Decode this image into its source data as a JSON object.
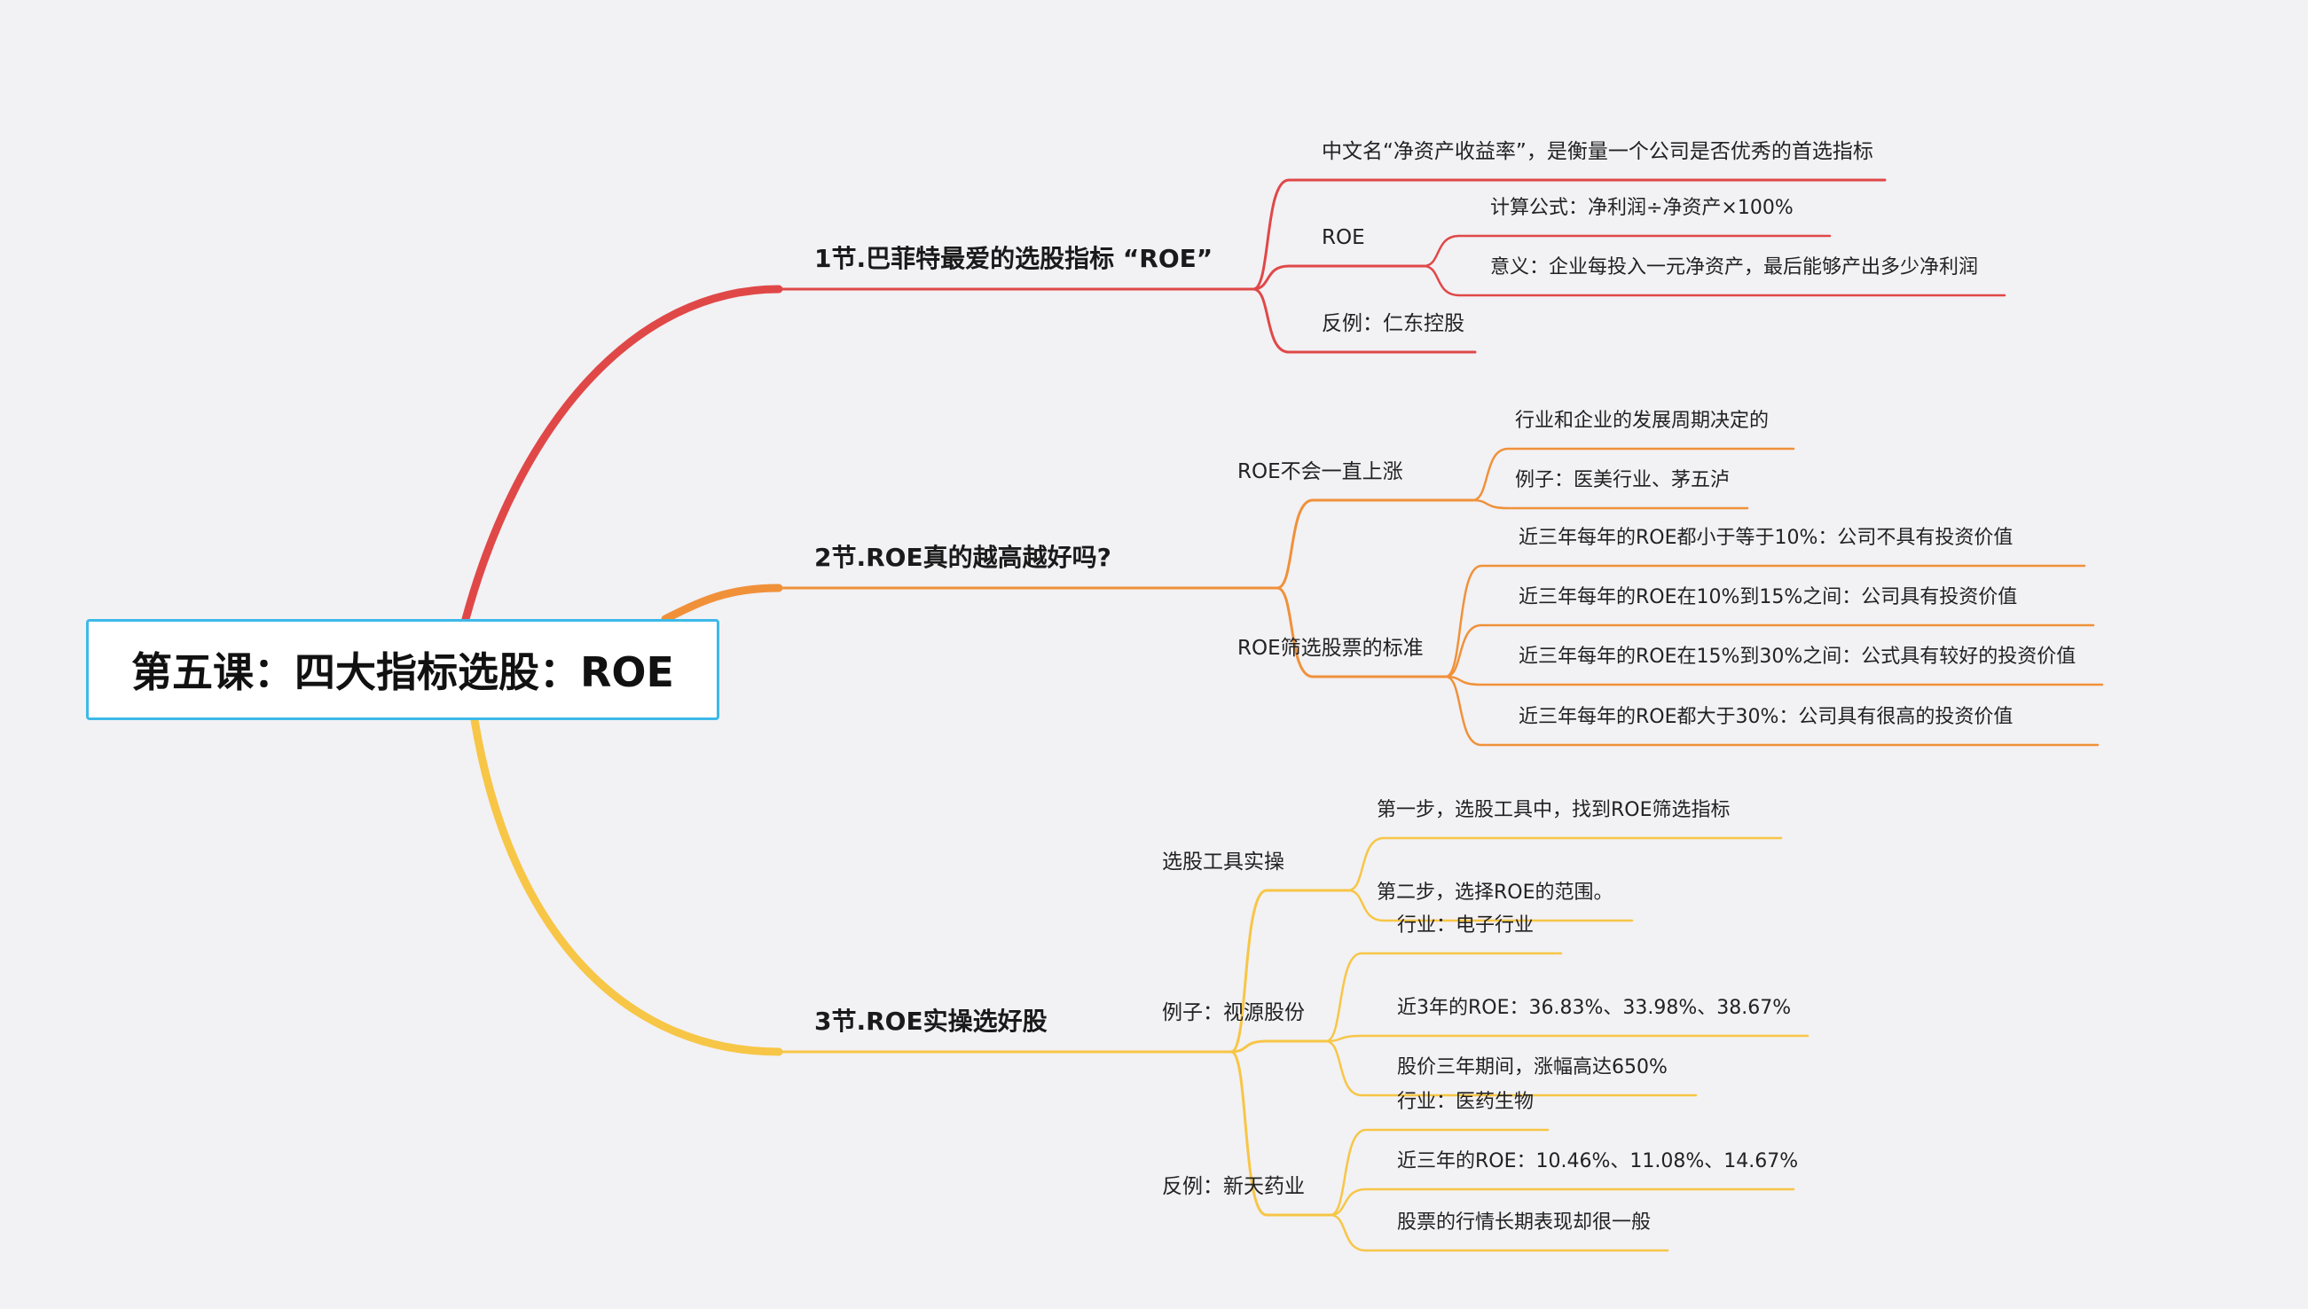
{
  "root": {
    "label": "第五课：四大指标选股：ROE",
    "border_color": "#3cb9e8"
  },
  "sections": [
    {
      "label": "1节.巴菲特最爱的选股指标 “ROE”",
      "color": "#e04848",
      "children": [
        {
          "label": "中文名“净资产收益率”，是衡量一个公司是否优秀的首选指标",
          "children": []
        },
        {
          "label": "ROE",
          "children": [
            {
              "label": "计算公式：净利润÷净资产×100%"
            },
            {
              "label": "意义：企业每投入一元净资产，最后能够产出多少净利润"
            }
          ]
        },
        {
          "label": "反例：仁东控股",
          "children": []
        }
      ]
    },
    {
      "label": "2节.ROE真的越高越好吗?",
      "color": "#f0913a",
      "children": [
        {
          "label": "ROE不会一直上涨",
          "children": [
            {
              "label": "行业和企业的发展周期决定的"
            },
            {
              "label": "例子：医美行业、茅五泸"
            }
          ]
        },
        {
          "label": "ROE筛选股票的标准",
          "children": [
            {
              "label": "近三年每年的ROE都小于等于10%：公司不具有投资价值"
            },
            {
              "label": "近三年每年的ROE在10%到15%之间：公司具有投资价值"
            },
            {
              "label": "近三年每年的ROE在15%到30%之间：公式具有较好的投资价值"
            },
            {
              "label": "近三年每年的ROE都大于30%：公司具有很高的投资价值"
            }
          ]
        }
      ]
    },
    {
      "label": "3节.ROE实操选好股",
      "color": "#f7c646",
      "children": [
        {
          "label": "选股工具实操",
          "children": [
            {
              "label": "第一步，选股工具中，找到ROE筛选指标"
            },
            {
              "label": "第二步，选择ROE的范围。"
            }
          ]
        },
        {
          "label": "例子：视源股份",
          "children": [
            {
              "label": "行业：电子行业"
            },
            {
              "label": "近3年的ROE：36.83%、33.98%、38.67%"
            },
            {
              "label": "股价三年期间，涨幅高达650%"
            }
          ]
        },
        {
          "label": "反例：新天药业",
          "children": [
            {
              "label": "行业：医药生物"
            },
            {
              "label": "近三年的ROE：10.46%、11.08%、14.67%"
            },
            {
              "label": "股票的行情长期表现却很一般"
            }
          ]
        }
      ]
    }
  ]
}
